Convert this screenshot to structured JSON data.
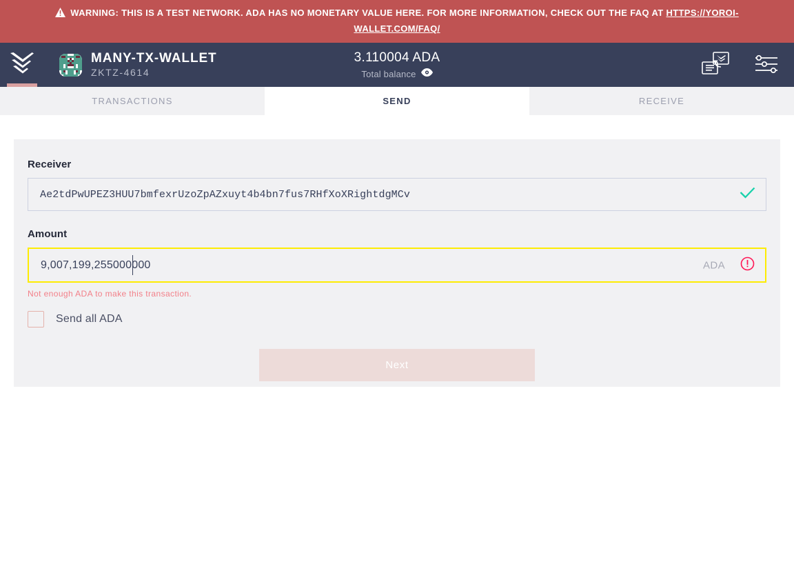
{
  "warning": {
    "icon": "warning-triangle-icon",
    "text": "WARNING: THIS IS A TEST NETWORK. ADA HAS NO MONETARY VALUE HERE. FOR MORE INFORMATION, CHECK OUT THE FAQ AT ",
    "link_text": "HTTPS://YOROI-WALLET.COM/FAQ/",
    "background_color": "#bf5353"
  },
  "navbar": {
    "logo_icon": "yoroi-logo-icon",
    "wallet_avatar_icon": "wallet-identicon-avatar",
    "wallet_name": "MANY-TX-WALLET",
    "wallet_id": "ZKTZ-4614",
    "balance_amount": "3.110004 ADA",
    "balance_label": "Total balance",
    "balance_visibility_icon": "eye-icon",
    "switch_wallet_icon": "switch-wallet-icon",
    "settings_icon": "settings-sliders-icon",
    "background_color": "#38405a"
  },
  "tabs": [
    {
      "label": "TRANSACTIONS",
      "active": false,
      "name": "tab-transactions"
    },
    {
      "label": "SEND",
      "active": true,
      "name": "tab-send"
    },
    {
      "label": "RECEIVE",
      "active": false,
      "name": "tab-receive"
    }
  ],
  "form": {
    "receiver": {
      "label": "Receiver",
      "value": "Ae2tdPwUPEZ3HUU7bmfexrUzoZpAZxuyt4b4bn7fus7RHfXoXRightdgMCv",
      "placeholder": "Receiver",
      "valid_icon": "check-icon",
      "valid_color": "#17d1aa"
    },
    "amount": {
      "label": "Amount",
      "value": "9,007,199,255000000",
      "caret_after": "9,007,199,255",
      "unit": "ADA",
      "placeholder": "Amount",
      "error_icon": "error-exclamation-icon",
      "error_text": "Not enough ADA to make this transaction.",
      "error_color": "#f27f88",
      "border_color": "#fdec02"
    },
    "send_all": {
      "label": "Send all ADA",
      "checked": false
    },
    "next_button": {
      "label": "Next",
      "disabled": true
    }
  }
}
